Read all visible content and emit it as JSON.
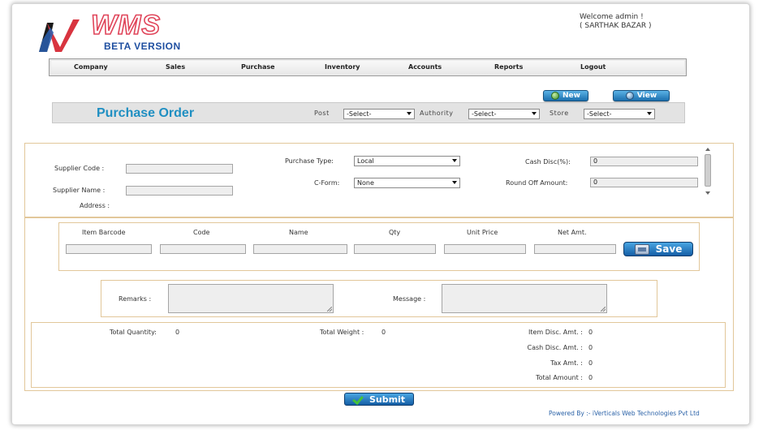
{
  "header": {
    "logo_text": "WMS",
    "logo_subtitle": "BETA VERSION",
    "welcome": "Welcome admin !",
    "company": "( SARTHAK BAZAR )"
  },
  "menu": {
    "items": [
      "Company",
      "Sales",
      "Purchase",
      "Inventory",
      "Accounts",
      "Reports",
      "Logout"
    ]
  },
  "actions": {
    "new_label": "New",
    "view_label": "View"
  },
  "titlebar": {
    "title": "Purchase Order",
    "post_label": "Post",
    "post_value": "-Select-",
    "authority_label": "Authority",
    "authority_value": "-Select-",
    "store_label": "Store",
    "store_value": "-Select-"
  },
  "supplier": {
    "code_label": "Supplier Code :",
    "code_value": "",
    "name_label": "Supplier Name :",
    "name_value": "",
    "address_label": "Address :",
    "purchase_type_label": "Purchase Type:",
    "purchase_type_value": "Local",
    "cform_label": "C-Form:",
    "cform_value": "None",
    "cash_disc_label": "Cash Disc(%):",
    "cash_disc_value": "0",
    "round_off_label": "Round Off Amount:",
    "round_off_value": "0"
  },
  "items": {
    "columns": [
      "Item Barcode",
      "Code",
      "Name",
      "Qty",
      "Unit Price",
      "Net Amt."
    ],
    "save_label": "Save"
  },
  "notes": {
    "remarks_label": "Remarks :",
    "message_label": "Message :"
  },
  "totals": {
    "total_quantity_label": "Total Quantity:",
    "total_quantity_value": "0",
    "total_weight_label": "Total Weight :",
    "total_weight_value": "0",
    "item_disc_label": "Item Disc. Amt. :",
    "item_disc_value": "0",
    "cash_disc_label": "Cash Disc. Amt. :",
    "cash_disc_value": "0",
    "tax_label": "Tax Amt. :",
    "tax_value": "0",
    "total_amount_label": "Total Amount :",
    "total_amount_value": "0"
  },
  "footer": {
    "submit_label": "Submit",
    "powered_by": "Powered By :- iVerticals Web Technologies Pvt Ltd"
  },
  "colors": {
    "accent_blue": "#1f8fc2",
    "logo_red": "#e0455a",
    "panel_border": "#e2c79a",
    "button_blue": "#1b6fae"
  }
}
